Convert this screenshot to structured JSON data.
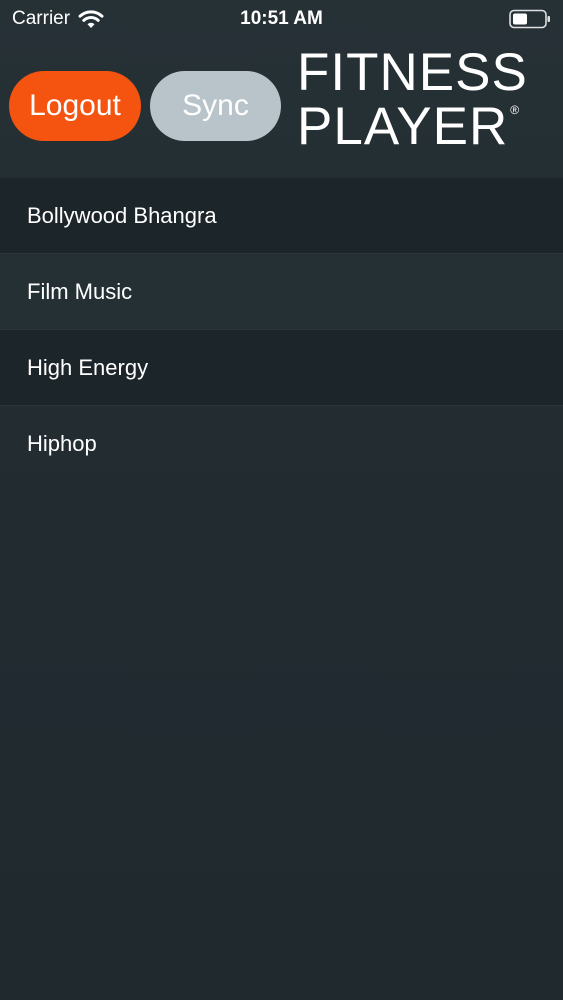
{
  "status_bar": {
    "carrier": "Carrier",
    "time": "10:51 AM",
    "icons": [
      "wifi-icon",
      "battery-icon"
    ]
  },
  "header": {
    "logout_label": "Logout",
    "sync_label": "Sync",
    "logo_line1": "FITNESS",
    "logo_line2": "PLAYER",
    "logo_mark": "®"
  },
  "playlists": [
    {
      "label": "Bollywood Bhangra"
    },
    {
      "label": "Film Music"
    },
    {
      "label": "High Energy"
    },
    {
      "label": "Hiphop"
    }
  ],
  "colors": {
    "background": "#222c31",
    "logout_button": "#f55410",
    "sync_button": "#b9c4ca",
    "text": "#ffffff"
  }
}
